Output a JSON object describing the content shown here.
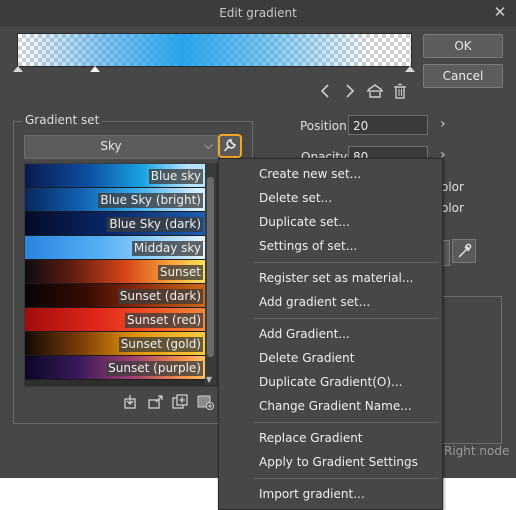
{
  "window": {
    "title": "Edit gradient",
    "close_label": "✕"
  },
  "buttons": {
    "ok": "OK",
    "cancel": "Cancel"
  },
  "gradient_set": {
    "legend": "Gradient set",
    "selected": "Sky",
    "items": [
      {
        "label": "Blue sky"
      },
      {
        "label": "Blue Sky (bright)"
      },
      {
        "label": "Blue Sky (dark)"
      },
      {
        "label": "Midday sky"
      },
      {
        "label": "Sunset"
      },
      {
        "label": "Sunset (dark)"
      },
      {
        "label": "Sunset (red)"
      },
      {
        "label": "Sunset (gold)"
      },
      {
        "label": "Sunset (purple)"
      }
    ]
  },
  "fields": {
    "position_label": "Position:",
    "position_value": "20",
    "opacity_label": "Opacity:",
    "opacity_value": "80"
  },
  "partial_labels": {
    "color1": "olor",
    "color2": "olor",
    "right_node": "Right node"
  },
  "menu": {
    "items": [
      "Create new set...",
      "Delete set...",
      "Duplicate set...",
      "Settings of set...",
      "Register set as material...",
      "Add gradient set...",
      "Add Gradient...",
      "Delete Gradient",
      "Duplicate Gradient(O)...",
      "Change Gradient Name...",
      "Replace Gradient",
      "Apply to Gradient Settings",
      "Import gradient..."
    ]
  },
  "icons": {
    "prev": "chevron-left-icon",
    "next": "chevron-right-icon",
    "flip": "flip-icon",
    "trash": "trash-icon",
    "wrench": "wrench-icon",
    "eyedropper": "eyedropper-icon"
  },
  "colors": {
    "accent": "#f5a623",
    "dialog_bg": "#474747",
    "titlebar_bg": "#3c3c3c",
    "gradient_blue": "#1ea0eb"
  }
}
